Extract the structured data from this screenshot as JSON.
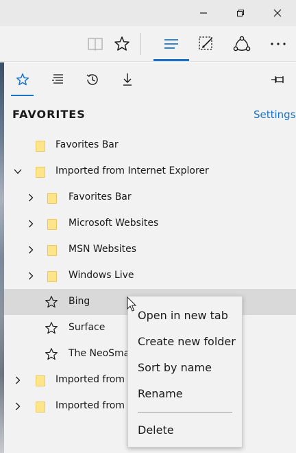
{
  "titlebar": {
    "icons": [
      "minimize-icon",
      "maximize-icon",
      "close-icon"
    ]
  },
  "toolbar": {
    "icons": [
      "reading-view-icon",
      "add-favorite-star-icon",
      "hub-icon",
      "web-note-icon",
      "share-icon",
      "more-icon"
    ],
    "more_label": "⋯"
  },
  "hub": {
    "tabs": [
      "favorites-icon",
      "reading-list-icon",
      "history-icon",
      "downloads-icon"
    ],
    "active_tab": "favorites",
    "pin_icon": "pin-icon",
    "header": "FAVORITES",
    "settings_label": "Settings",
    "accent": "#1a73c8",
    "items": [
      {
        "label": "Favorites Bar",
        "type": "folder",
        "expander": "none"
      },
      {
        "label": "Imported from Internet Explorer",
        "type": "folder",
        "expander": "expanded"
      },
      {
        "label": "Favorites Bar",
        "type": "folder",
        "expander": "collapsed"
      },
      {
        "label": "Microsoft Websites",
        "type": "folder",
        "expander": "collapsed"
      },
      {
        "label": "MSN Websites",
        "type": "folder",
        "expander": "collapsed"
      },
      {
        "label": "Windows Live",
        "type": "folder",
        "expander": "collapsed"
      },
      {
        "label": "Bing",
        "type": "favorite",
        "selected": true
      },
      {
        "label": "Surface",
        "type": "favorite"
      },
      {
        "label": "The NeoSma",
        "type": "favorite"
      },
      {
        "label": "Imported from",
        "type": "folder",
        "expander": "collapsed"
      },
      {
        "label": "Imported from",
        "type": "folder",
        "expander": "collapsed"
      }
    ]
  },
  "context_menu": {
    "items": [
      "Open in new tab",
      "Create new folder",
      "Sort by name",
      "Rename",
      "Delete"
    ]
  }
}
